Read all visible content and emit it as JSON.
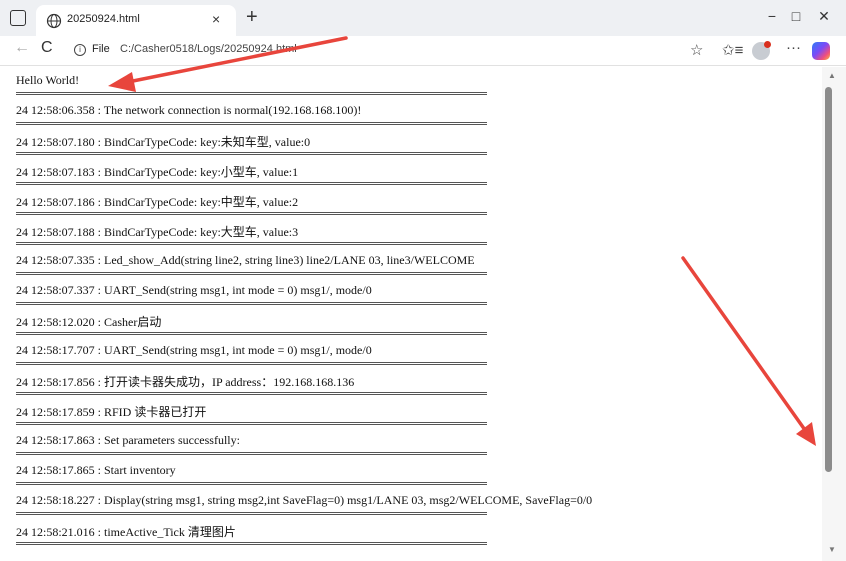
{
  "browser": {
    "tab_title": "20250924.html",
    "tab_close_glyph": "×",
    "new_tab_glyph": "+",
    "window_buttons": {
      "minimize": "−",
      "maximize": "□",
      "close": "✕"
    },
    "nav": {
      "back": "←",
      "refresh": "C"
    },
    "address": {
      "info": "i",
      "file_label": "File",
      "url": "C:/Casher0518/Logs/20250924.html"
    },
    "toolbar_icons": {
      "star": "☆",
      "favorites": "✩≡",
      "more": "···"
    }
  },
  "log": {
    "header": "Hello World!",
    "entries": [
      "24 12:58:06.358 : The network connection is normal(192.168.168.100)!",
      "24 12:58:07.180 : BindCarTypeCode: key:未知车型, value:0",
      "24 12:58:07.183 : BindCarTypeCode: key:小型车, value:1",
      "24 12:58:07.186 : BindCarTypeCode: key:中型车, value:2",
      "24 12:58:07.188 : BindCarTypeCode: key:大型车, value:3",
      "24 12:58:07.335 : Led_show_Add(string line2, string line3) line2/LANE 03, line3/WELCOME",
      "24 12:58:07.337 : UART_Send(string msg1, int mode = 0) msg1/, mode/0",
      "24 12:58:12.020 : Casher启动",
      "24 12:58:17.707 : UART_Send(string msg1, int mode = 0) msg1/, mode/0",
      "24 12:58:17.856 : 打开读卡器失成功，IP address：192.168.168.136",
      "24 12:58:17.859 : RFID 读卡器已打开",
      "24 12:58:17.863 : Set parameters successfully:",
      "24 12:58:17.865 : Start inventory",
      "24 12:58:18.227 : Display(string msg1, string msg2,int SaveFlag=0) msg1/LANE 03, msg2/WELCOME, SaveFlag=0/0",
      "24 12:58:21.016 : timeActive_Tick 清理图片"
    ]
  },
  "scrollbar": {
    "up": "▲",
    "down": "▼"
  },
  "colors": {
    "annotation_arrow": "#e8453c",
    "titlebar": "#eef0f3"
  }
}
